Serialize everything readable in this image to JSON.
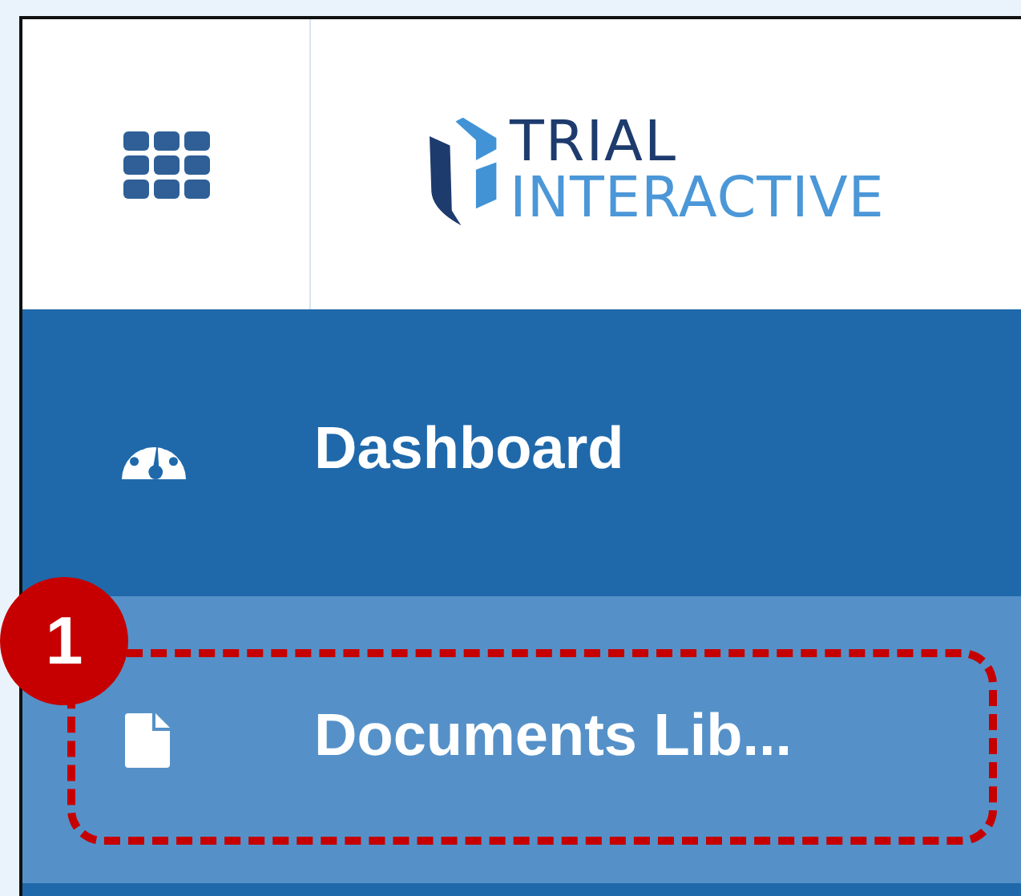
{
  "header": {
    "logo_line_1": "TRIAL",
    "logo_line_2": "INTERACTIVE"
  },
  "nav": [
    {
      "label": "Dashboard",
      "kind": "dashboard",
      "selected": false
    },
    {
      "label": "Documents Lib...",
      "kind": "document",
      "selected": true,
      "callout": "1"
    }
  ]
}
